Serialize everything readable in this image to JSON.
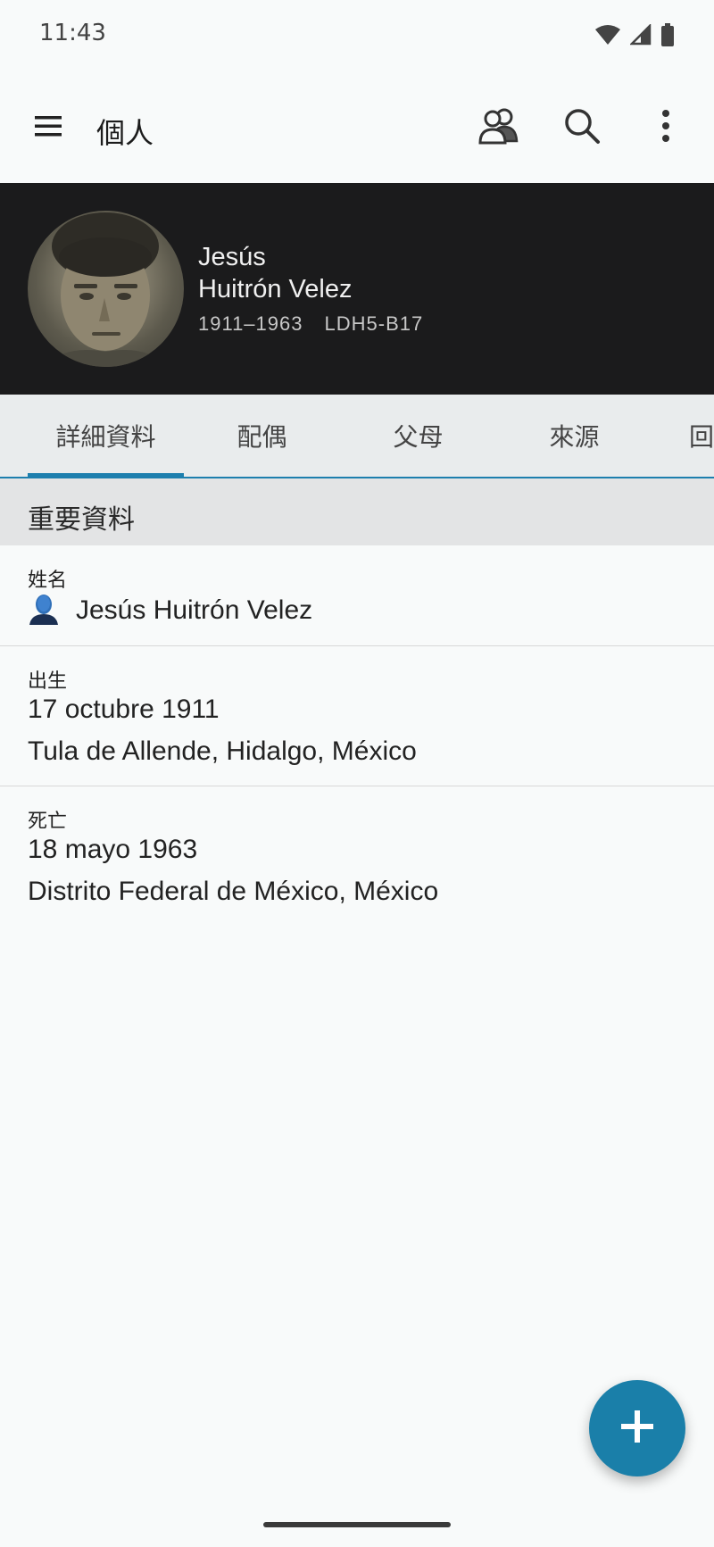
{
  "status_bar": {
    "time": "11:43",
    "icons": [
      "wifi-icon",
      "cell-signal-icon",
      "battery-icon"
    ]
  },
  "app_bar": {
    "title": "個人",
    "icons": [
      "menu-icon",
      "people-icon",
      "search-icon",
      "more-vert-icon"
    ]
  },
  "person": {
    "given_name": "Jesús",
    "surname": "Huitrón Velez",
    "lifespan": "1911–1963",
    "id": "LDH5-B17"
  },
  "tabs": [
    {
      "label": "詳細資料",
      "active": true
    },
    {
      "label": "配偶",
      "active": false
    },
    {
      "label": "父母",
      "active": false
    },
    {
      "label": "來源",
      "active": false
    },
    {
      "label": "回",
      "active": false
    }
  ],
  "section": {
    "title": "重要資料",
    "rows": [
      {
        "label": "姓名",
        "icon": "person-icon",
        "lines": [
          "Jesús Huitrón Velez"
        ]
      },
      {
        "label": "出生",
        "lines": [
          "17 octubre 1911",
          "Tula de Allende, Hidalgo, México"
        ]
      },
      {
        "label": "死亡",
        "lines": [
          "18 mayo 1963",
          "Distrito Federal de México, México"
        ]
      }
    ]
  },
  "fab": {
    "icon": "add-icon"
  },
  "colors": {
    "accent": "#1a7fa9",
    "header_bg": "#1b1b1c",
    "tab_bg": "#e9eced",
    "section_bg": "#e3e4e5"
  }
}
